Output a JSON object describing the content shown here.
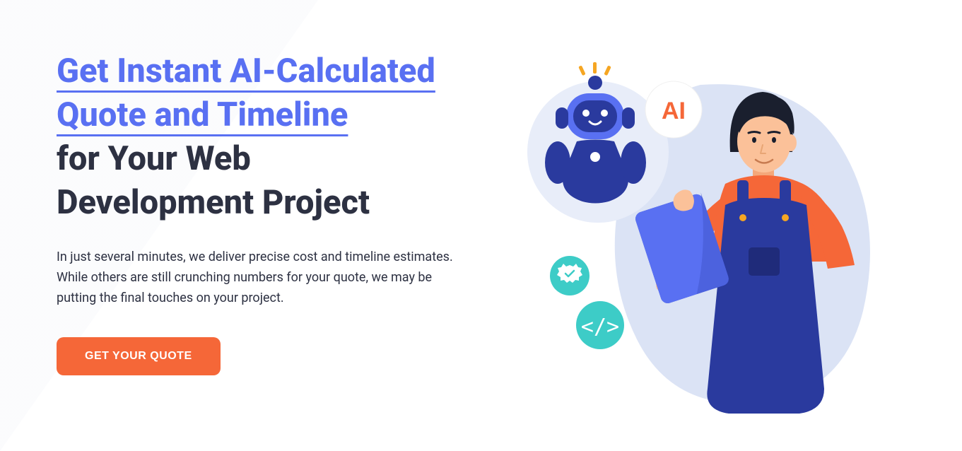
{
  "hero": {
    "heading_highlight_line1": "Get Instant AI-Calculated",
    "heading_highlight_line2": "Quote and Timeline",
    "heading_dark_line1": "for Your Web",
    "heading_dark_line2": "Development Project",
    "description": "In just several minutes, we deliver precise cost and timeline estimates. While others are still crunching numbers for your quote, we may be putting the final touches on your project.",
    "cta_label": "GET YOUR QUOTE",
    "ai_badge": "AI"
  }
}
